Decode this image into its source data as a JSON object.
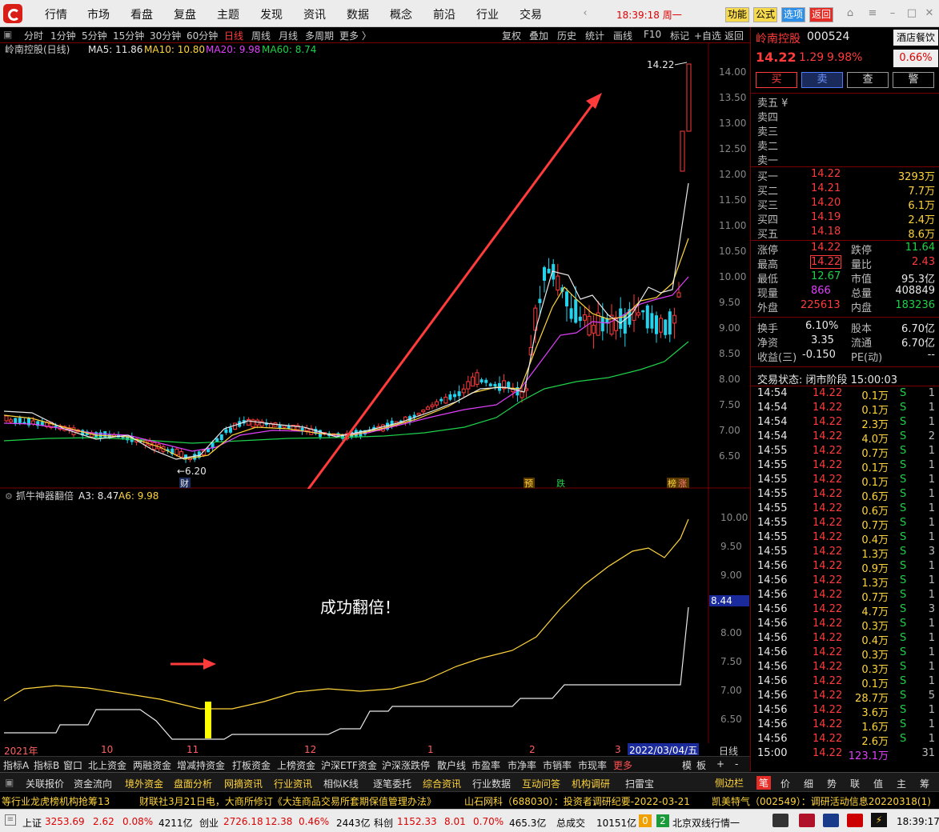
{
  "topbar": {
    "menus": [
      "行情",
      "市场",
      "看盘",
      "复盘",
      "主题",
      "发现",
      "资讯",
      "数据",
      "概念",
      "前沿",
      "行业",
      "交易"
    ],
    "clock": "18:39:18 周一",
    "buttons": [
      "功能",
      "公式",
      "选项",
      "返回"
    ]
  },
  "chart_toolbar": {
    "periods": [
      "分时",
      "1分钟",
      "5分钟",
      "15分钟",
      "30分钟",
      "60分钟",
      "日线",
      "周线",
      "月线",
      "多周期",
      "更多 〉"
    ],
    "active": "日线",
    "tools": [
      "复权",
      "叠加",
      "历史",
      "统计",
      "画线",
      "F10",
      "标记",
      "+自选",
      "返回"
    ]
  },
  "main_legend": {
    "title": "岭南控股(日线)",
    "ma5": "MA5: 11.86",
    "ma10": "MA10: 10.80",
    "ma20": "MA20: 9.98",
    "ma60": "MA60: 8.74"
  },
  "main_axis": {
    "ticks": [
      "14.00",
      "13.50",
      "13.00",
      "12.50",
      "12.00",
      "11.50",
      "11.00",
      "10.50",
      "10.00",
      "9.50",
      "9.00",
      "8.50",
      "8.00",
      "7.50",
      "7.00",
      "6.50"
    ]
  },
  "annotations": {
    "high_label": "14.22",
    "low_label": "←6.20",
    "cai": "财",
    "yu": "预",
    "die": "跌",
    "bang": "榜",
    "zhang": "涨",
    "success": "成功翻倍！"
  },
  "ind_legend": {
    "title": "抓牛神器翻倍",
    "a3": "A3: 8.47",
    "a6": "A6: 9.98"
  },
  "ind_axis": {
    "ticks": [
      "10.00",
      "9.50",
      "9.00",
      "8.00",
      "7.50",
      "7.00",
      "6.50"
    ],
    "current": "8.44"
  },
  "datebar": {
    "labels": [
      "2021年",
      "10",
      "11",
      "12",
      "1",
      "2",
      "3"
    ],
    "current": "2022/03/04/五",
    "period": "日线"
  },
  "tabs_row": {
    "items": [
      "指标A",
      "指标B",
      "窗口",
      "北上资金",
      "两融资金",
      "增减持资金",
      "打板资金",
      "上榜资金",
      "沪深ETF资金",
      "沪深涨跌停",
      "散户线",
      "市盈率",
      "市净率",
      "市销率",
      "市现率",
      "更多"
    ],
    "right": [
      "模",
      "板",
      "+",
      "-"
    ]
  },
  "bottom_tabs": {
    "items": [
      "关联报价",
      "资金流向",
      "境外资金",
      "盘面分析",
      "网摘资讯",
      "行业资讯",
      "相似K线",
      "逐笔委托",
      "综合资讯",
      "行业数据",
      "互动问答",
      "机构调研",
      "扫雷宝"
    ],
    "side": "侧边栏",
    "right": [
      "笔",
      "价",
      "细",
      "势",
      "联",
      "值",
      "主",
      "筹"
    ]
  },
  "ticker": {
    "items": [
      "等行业龙虎榜机构抢筹13",
      "财联社3月21日电，大商所修订《大连商品交易所套期保值管理办法》",
      "山石网科（688030）：投资者调研纪要-2022-03-21",
      "凯美特气（002549）：调研活动信息20220318(1)"
    ]
  },
  "status": {
    "sh_label": "上证",
    "sh": "3253.69",
    "sh_chg": "2.62",
    "sh_pct": "0.08%",
    "sh_amt": "4211亿",
    "cy_label": "创业",
    "cy": "2726.18",
    "cy_chg": "12.38",
    "cy_pct": "0.46%",
    "cy_amt": "2443亿",
    "kc_label": "科创",
    "kc": "1152.33",
    "kc_chg": "8.01",
    "kc_pct": "0.70%",
    "kc_amt": "465.3亿",
    "total_label": "总成交",
    "total": "10151亿",
    "badge1": "0",
    "badge2": "2",
    "feed": "北京双线行情一",
    "time": "18:39:17"
  },
  "stock": {
    "name": "岭南控股",
    "code": "000524",
    "industry": "酒店餐饮",
    "price": "14.22",
    "change": "1.29",
    "pct": "9.98%",
    "industry_pct": "0.66%",
    "buttons": [
      "买",
      "卖",
      "查",
      "警"
    ]
  },
  "asks": [
    {
      "label": "卖五 ¥",
      "price": "",
      "vol": ""
    },
    {
      "label": "卖四",
      "price": "",
      "vol": ""
    },
    {
      "label": "卖三",
      "price": "",
      "vol": ""
    },
    {
      "label": "卖二",
      "price": "",
      "vol": ""
    },
    {
      "label": "卖一",
      "price": "",
      "vol": ""
    }
  ],
  "bids": [
    {
      "label": "买一",
      "price": "14.22",
      "vol": "3293万"
    },
    {
      "label": "买二",
      "price": "14.21",
      "vol": "7.7万"
    },
    {
      "label": "买三",
      "price": "14.20",
      "vol": "6.1万"
    },
    {
      "label": "买四",
      "price": "14.19",
      "vol": "2.4万"
    },
    {
      "label": "买五",
      "price": "14.18",
      "vol": "8.6万"
    }
  ],
  "stats": [
    {
      "l1": "涨停",
      "v1": "14.22",
      "l2": "跌停",
      "v2": "11.64"
    },
    {
      "l1": "最高",
      "v1": "14.22",
      "l2": "量比",
      "v2": "2.43"
    },
    {
      "l1": "最低",
      "v1": "12.67",
      "l2": "市值",
      "v2": "95.3亿"
    },
    {
      "l1": "现量",
      "v1": "866",
      "l2": "总量",
      "v2": "408849"
    },
    {
      "l1": "外盘",
      "v1": "225613",
      "l2": "内盘",
      "v2": "183236"
    }
  ],
  "fund": [
    {
      "l1": "换手",
      "v1": "6.10%",
      "l2": "股本",
      "v2": "6.70亿"
    },
    {
      "l1": "净资",
      "v1": "3.35",
      "l2": "流通",
      "v2": "6.70亿"
    },
    {
      "l1": "收益(三)",
      "v1": "-0.150",
      "l2": "PE(动)",
      "v2": "--"
    }
  ],
  "trade_status": "交易状态: 闭市阶段 15:00:03",
  "ticks": [
    {
      "t": "14:54",
      "p": "14.22",
      "v": "0.1万",
      "s": "S",
      "n": "1"
    },
    {
      "t": "14:54",
      "p": "14.22",
      "v": "0.1万",
      "s": "S",
      "n": "1"
    },
    {
      "t": "14:54",
      "p": "14.22",
      "v": "2.3万",
      "s": "S",
      "n": "1"
    },
    {
      "t": "14:54",
      "p": "14.22",
      "v": "4.0万",
      "s": "S",
      "n": "2"
    },
    {
      "t": "14:55",
      "p": "14.22",
      "v": "0.7万",
      "s": "S",
      "n": "1"
    },
    {
      "t": "14:55",
      "p": "14.22",
      "v": "0.1万",
      "s": "S",
      "n": "1"
    },
    {
      "t": "14:55",
      "p": "14.22",
      "v": "0.1万",
      "s": "S",
      "n": "1"
    },
    {
      "t": "14:55",
      "p": "14.22",
      "v": "0.6万",
      "s": "S",
      "n": "1"
    },
    {
      "t": "14:55",
      "p": "14.22",
      "v": "0.6万",
      "s": "S",
      "n": "1"
    },
    {
      "t": "14:55",
      "p": "14.22",
      "v": "0.7万",
      "s": "S",
      "n": "1"
    },
    {
      "t": "14:55",
      "p": "14.22",
      "v": "0.4万",
      "s": "S",
      "n": "1"
    },
    {
      "t": "14:55",
      "p": "14.22",
      "v": "1.3万",
      "s": "S",
      "n": "3"
    },
    {
      "t": "14:56",
      "p": "14.22",
      "v": "0.9万",
      "s": "S",
      "n": "1"
    },
    {
      "t": "14:56",
      "p": "14.22",
      "v": "1.3万",
      "s": "S",
      "n": "1"
    },
    {
      "t": "14:56",
      "p": "14.22",
      "v": "0.7万",
      "s": "S",
      "n": "1"
    },
    {
      "t": "14:56",
      "p": "14.22",
      "v": "4.7万",
      "s": "S",
      "n": "3"
    },
    {
      "t": "14:56",
      "p": "14.22",
      "v": "0.3万",
      "s": "S",
      "n": "1"
    },
    {
      "t": "14:56",
      "p": "14.22",
      "v": "0.4万",
      "s": "S",
      "n": "1"
    },
    {
      "t": "14:56",
      "p": "14.22",
      "v": "0.3万",
      "s": "S",
      "n": "1"
    },
    {
      "t": "14:56",
      "p": "14.22",
      "v": "0.3万",
      "s": "S",
      "n": "1"
    },
    {
      "t": "14:56",
      "p": "14.22",
      "v": "0.1万",
      "s": "S",
      "n": "1"
    },
    {
      "t": "14:56",
      "p": "14.22",
      "v": "28.7万",
      "s": "S",
      "n": "5"
    },
    {
      "t": "14:56",
      "p": "14.22",
      "v": "3.6万",
      "s": "S",
      "n": "1"
    },
    {
      "t": "14:56",
      "p": "14.22",
      "v": "1.6万",
      "s": "S",
      "n": "1"
    },
    {
      "t": "14:56",
      "p": "14.22",
      "v": "2.6万",
      "s": "S",
      "n": "1"
    },
    {
      "t": "15:00",
      "p": "14.22",
      "v": "123.1万",
      "s": "",
      "n": "31"
    }
  ]
}
